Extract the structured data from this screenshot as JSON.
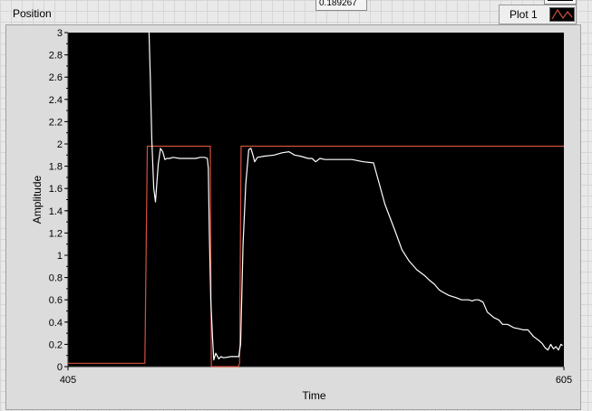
{
  "header": {
    "position_label": "Position",
    "indicator_value": "0.189267"
  },
  "legend": {
    "plot_label": "Plot 1",
    "plot_color": "#d2503c"
  },
  "colors": {
    "plot_background": "#000000",
    "setpoint_line": "#d2503c",
    "response_line": "#ffffff"
  },
  "chart_data": {
    "type": "line",
    "title": "",
    "xlabel": "Time",
    "ylabel": "Amplitude",
    "xlim": [
      405,
      605
    ],
    "ylim": [
      0,
      3
    ],
    "x_ticks": [
      "405",
      "605"
    ],
    "y_ticks": [
      "0",
      "0.2",
      "0.4",
      "0.6",
      "0.8",
      "1",
      "1.2",
      "1.4",
      "1.6",
      "1.8",
      "2",
      "2.2",
      "2.4",
      "2.6",
      "2.8",
      "3"
    ],
    "grid": false,
    "series": [
      {
        "name": "Plot 1",
        "color": "#d2503c",
        "x": [
          405,
          436,
          437,
          438.3,
          461.2,
          462.4,
          462.8,
          463.2,
          473.7,
          474.2,
          474.8,
          605
        ],
        "y": [
          0.03,
          0.03,
          1.98,
          1.98,
          1.98,
          1.98,
          0,
          0,
          0,
          0.03,
          1.98,
          1.98
        ]
      },
      {
        "name": "",
        "color": "#ffffff",
        "x": [
          437.7,
          438.2,
          438.8,
          439.6,
          440.3,
          440.9,
          441.4,
          442.3,
          443.2,
          444.1,
          444.9,
          446,
          447.3,
          450.1,
          453.9,
          456.5,
          458.4,
          460.1,
          461.2,
          461.6,
          462,
          462.6,
          463.3,
          463.8,
          464.6,
          465.8,
          466.7,
          467.8,
          470.8,
          473.9,
          474.6,
          475.6,
          476.7,
          477.9,
          478.8,
          479.6,
          480.3,
          481.4,
          484.2,
          488.1,
          491.3,
          494.1,
          496.4,
          498.7,
          501.9,
          503.4,
          504.9,
          506.6,
          508.6,
          510.3,
          512.5,
          515.3,
          519.5,
          524.1,
          528.2,
          532.8,
          536.9,
          539.7,
          542.5,
          545.7,
          548.7,
          550.6,
          552.8,
          554.7,
          556.1,
          558.6,
          561.4,
          563.7,
          566.6,
          568,
          569.2,
          570.6,
          572.4,
          574.1,
          576.8,
          578.7,
          580.3,
          582.3,
          584.7,
          586.9,
          588.8,
          590.5,
          592.8,
          594.6,
          596.2,
          597.4,
          598.6,
          599.7,
          600.8,
          601.8,
          602.8,
          603.8,
          604.5
        ],
        "y": [
          3,
          2.6,
          2.05,
          1.6,
          1.48,
          1.67,
          1.82,
          1.96,
          1.93,
          1.86,
          1.87,
          1.87,
          1.88,
          1.87,
          1.87,
          1.87,
          1.88,
          1.88,
          1.87,
          1.78,
          1.2,
          0.6,
          0.25,
          0.06,
          0.12,
          0.07,
          0.09,
          0.08,
          0.09,
          0.09,
          0.2,
          1.1,
          1.64,
          1.95,
          1.96,
          1.9,
          1.84,
          1.88,
          1.89,
          1.9,
          1.92,
          1.93,
          1.9,
          1.89,
          1.87,
          1.87,
          1.84,
          1.87,
          1.86,
          1.86,
          1.86,
          1.86,
          1.86,
          1.84,
          1.83,
          1.46,
          1.22,
          1.05,
          0.95,
          0.87,
          0.82,
          0.78,
          0.74,
          0.69,
          0.67,
          0.64,
          0.62,
          0.6,
          0.6,
          0.59,
          0.6,
          0.6,
          0.58,
          0.49,
          0.44,
          0.42,
          0.38,
          0.38,
          0.35,
          0.34,
          0.33,
          0.33,
          0.27,
          0.24,
          0.21,
          0.17,
          0.15,
          0.2,
          0.16,
          0.18,
          0.15,
          0.2,
          0.19
        ]
      }
    ]
  }
}
